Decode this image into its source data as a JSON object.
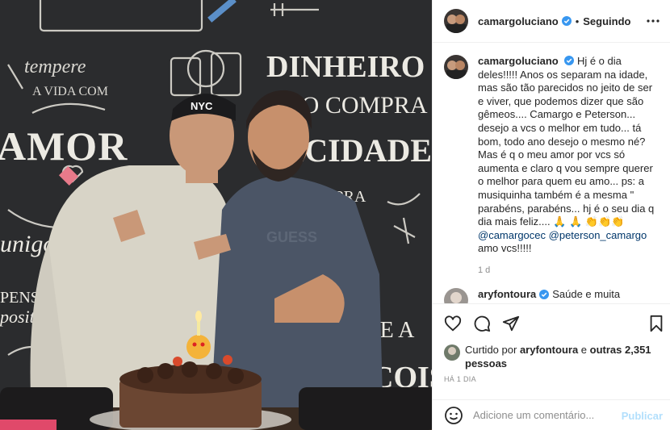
{
  "post": {
    "username": "camargoluciano",
    "follow_state": "Seguindo",
    "separator": "•"
  },
  "caption": {
    "username": "camargoluciano",
    "text": "Hj é o dia deles!!!!! Anos os separam na idade, mas são tão parecidos no jeito de ser e viver, que podemos dizer que são gêmeos.... Camargo e Peterson... desejo a vcs o melhor em tudo... tá bom, todo ano desejo o mesmo né? Mas é q o meu amor por vcs só aumenta e claro q vou sempre querer o melhor para quem eu amo... ps: a musiquinha também é a mesma \" parabéns, parabéns... hj é o seu dia q dia mais feliz.... 🙏 🙏 👏👏👏",
    "mention1": "@camargocec",
    "mention2": "@peterson_camargo",
    "closing": "amo vcs!!!!!",
    "time": "1 d"
  },
  "comment": {
    "username": "aryfontoura",
    "text": "Saúde e muita"
  },
  "likes": {
    "prefix": "Curtido por",
    "by": "aryfontoura",
    "and": "e",
    "others": "outras 2,351 pessoas"
  },
  "date": "HÁ 1 DIA",
  "add_comment": {
    "placeholder": "Adicione um comentário...",
    "publish_label": "Publicar"
  },
  "colors": {
    "verified": "#3897f0",
    "link": "#00376b",
    "publish_disabled": "#b2dffc",
    "muted": "#8e8e8e"
  },
  "icons": [
    "verified-badge-icon",
    "more-options-icon",
    "heart-icon",
    "comment-icon",
    "share-icon",
    "bookmark-icon",
    "emoji-icon"
  ]
}
